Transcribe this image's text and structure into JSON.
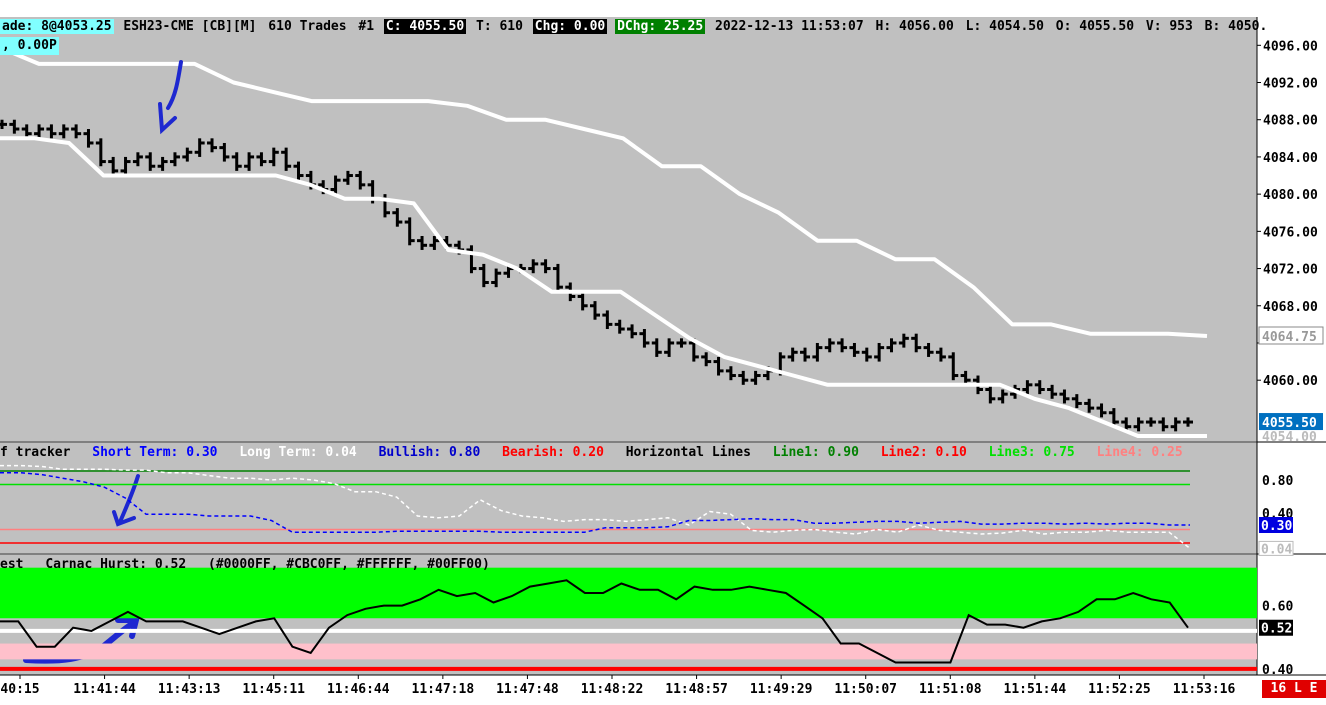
{
  "header": {
    "last_trade": "ade: 8@4053.25",
    "symbol": "ESH23-CME [CB][M]",
    "trades": "610 Trades",
    "num": "#1",
    "close": "C: 4055.50",
    "t": "T: 610",
    "chg": "Chg: 0.00",
    "dchg": "DChg: 25.25",
    "datetime": "2022-12-13 11:53:07",
    "high": "H: 4056.00",
    "low": "L: 4054.50",
    "open": "O: 4055.50",
    "volume": "V: 953",
    "bid": "B: 4050.",
    "sub": ", 0.00P"
  },
  "colors": {
    "chart_bg": "#C0C0C0",
    "price_axis_bg": "#FFFFFF",
    "cyan_label": "#80FFFF",
    "dchg_bg": "#008000",
    "price_tag_bg": "#0070C0",
    "short_term": "#0000FF",
    "long_term": "#FFFFFF",
    "bullish_zone": "#00FF00",
    "bearish_zone": "#FFC0CB",
    "red_line": "#FF0000"
  },
  "price_axis": {
    "labels": [
      "4096.00",
      "4092.00",
      "4088.00",
      "4084.00",
      "4080.00",
      "4076.00",
      "4072.00",
      "4068.00",
      "4064.75",
      "4060.00",
      "4055.50",
      "4054.00"
    ],
    "current_tag": "4055.50",
    "upper_band_tag": "4064.75",
    "lower_band_tag": "4054.00"
  },
  "panel2": {
    "title": "f tracker",
    "short_term": "Short Term: 0.30",
    "long_term": "Long Term: 0.04",
    "bullish": "Bullish: 0.80",
    "bearish": "Bearish: 0.20",
    "hlines": "Horizontal Lines",
    "line1": "Line1: 0.90",
    "line2": "Line2: 0.10",
    "line3": "Line3: 0.75",
    "line4": "Line4: 0.25",
    "axis": [
      "0.80",
      "0.40"
    ],
    "tag_short": "0.30",
    "tag_long": "0.04"
  },
  "panel3": {
    "title": "est",
    "carnac": "Carnac Hurst: 0.52",
    "colors_text": "(#0000FF, #CBC0FF, #FFFFFF, #00FF00)",
    "axis": [
      "0.60",
      "0.40"
    ],
    "tag": "0.52"
  },
  "time_axis": [
    "40:15",
    "11:41:44",
    "11:43:13",
    "11:45:11",
    "11:46:44",
    "11:47:18",
    "11:47:48",
    "11:48:22",
    "11:48:57",
    "11:49:29",
    "11:50:07",
    "11:51:08",
    "11:51:44",
    "11:52:25",
    "11:53:16"
  ],
  "status": "16 L E",
  "chart_data": [
    {
      "type": "bar",
      "name": "price",
      "ohlc_close": [
        4087.5,
        4087,
        4086.5,
        4087,
        4086.5,
        4087,
        4086.5,
        4085.5,
        4083.5,
        4082.5,
        4083.5,
        4084,
        4083,
        4083.5,
        4084,
        4084.5,
        4085.5,
        4085,
        4084,
        4083,
        4084,
        4083.5,
        4084.5,
        4083,
        4082,
        4081,
        4080.5,
        4081.5,
        4082,
        4081,
        4079.5,
        4078,
        4077,
        4075,
        4074.5,
        4075,
        4074.5,
        4074,
        4072,
        4070.5,
        4071.5,
        4072,
        4072,
        4072.5,
        4072,
        4070,
        4069,
        4068,
        4067,
        4066,
        4065.5,
        4065,
        4064,
        4063,
        4064,
        4064,
        4062.5,
        4062,
        4061,
        4060.5,
        4060,
        4060.5,
        4061,
        4062.5,
        4063,
        4062.5,
        4063.5,
        4064,
        4063.5,
        4063,
        4062.5,
        4063.5,
        4064,
        4064.5,
        4063.5,
        4063,
        4062.5,
        4060.5,
        4060,
        4059,
        4058,
        4058.5,
        4059,
        4059.5,
        4059,
        4058.5,
        4058,
        4057.5,
        4057,
        4056.5,
        4055.5,
        4055,
        4055.5,
        4055.5,
        4055,
        4055.5,
        4055.5
      ],
      "upper_band": [
        4095.75,
        4094,
        4094,
        4094,
        4094,
        4094,
        4092,
        4091,
        4090,
        4090,
        4090,
        4090,
        4089.5,
        4088,
        4088,
        4087,
        4086,
        4083,
        4083,
        4080,
        4078,
        4075,
        4075,
        4073,
        4073,
        4070,
        4066,
        4066,
        4065,
        4065,
        4065,
        4064.75
      ],
      "lower_band": [
        4086,
        4086,
        4085.5,
        4082,
        4082,
        4082,
        4082,
        4082,
        4082,
        4081,
        4079.5,
        4079.5,
        4079,
        4074,
        4073.5,
        4072,
        4069.5,
        4069.5,
        4069.5,
        4067,
        4064.5,
        4062.5,
        4061.5,
        4060.5,
        4059.5,
        4059.5,
        4059.5,
        4059.5,
        4059.5,
        4059.5,
        4058,
        4057,
        4055.5,
        4054,
        4054,
        4054
      ],
      "ylim": [
        4054,
        4097
      ]
    },
    {
      "type": "line",
      "name": "tracker",
      "series": [
        {
          "name": "Short Term",
          "values": [
            0.88,
            0.88,
            0.86,
            0.82,
            0.78,
            0.72,
            0.6,
            0.42,
            0.42,
            0.42,
            0.4,
            0.4,
            0.4,
            0.35,
            0.22,
            0.22,
            0.22,
            0.22,
            0.22,
            0.23,
            0.23,
            0.23,
            0.23,
            0.23,
            0.22,
            0.22,
            0.22,
            0.22,
            0.22,
            0.27,
            0.27,
            0.27,
            0.28,
            0.35,
            0.35,
            0.36,
            0.37,
            0.36,
            0.36,
            0.32,
            0.32,
            0.33,
            0.34,
            0.34,
            0.32,
            0.33,
            0.34,
            0.31,
            0.31,
            0.32,
            0.32,
            0.31,
            0.32,
            0.31,
            0.32,
            0.32,
            0.3,
            0.3
          ]
        },
        {
          "name": "Long Term",
          "values": [
            0.96,
            0.96,
            0.95,
            0.92,
            0.92,
            0.92,
            0.91,
            0.91,
            0.88,
            0.88,
            0.85,
            0.82,
            0.82,
            0.8,
            0.82,
            0.8,
            0.76,
            0.67,
            0.67,
            0.61,
            0.4,
            0.38,
            0.4,
            0.58,
            0.46,
            0.4,
            0.38,
            0.34,
            0.36,
            0.36,
            0.34,
            0.36,
            0.38,
            0.3,
            0.45,
            0.42,
            0.24,
            0.22,
            0.24,
            0.25,
            0.22,
            0.2,
            0.25,
            0.22,
            0.3,
            0.24,
            0.22,
            0.2,
            0.21,
            0.24,
            0.2,
            0.22,
            0.22,
            0.24,
            0.22,
            0.22,
            0.22,
            0.04
          ]
        }
      ],
      "hlines": [
        0.9,
        0.75,
        0.25,
        0.1
      ],
      "ylim": [
        0,
        1
      ]
    },
    {
      "type": "line",
      "name": "Carnac Hurst",
      "values": [
        0.55,
        0.55,
        0.47,
        0.47,
        0.53,
        0.52,
        0.55,
        0.58,
        0.55,
        0.55,
        0.55,
        0.53,
        0.51,
        0.53,
        0.55,
        0.56,
        0.47,
        0.45,
        0.53,
        0.57,
        0.59,
        0.6,
        0.6,
        0.62,
        0.65,
        0.63,
        0.64,
        0.61,
        0.63,
        0.66,
        0.67,
        0.68,
        0.64,
        0.64,
        0.67,
        0.65,
        0.65,
        0.62,
        0.66,
        0.65,
        0.65,
        0.66,
        0.65,
        0.64,
        0.6,
        0.56,
        0.48,
        0.48,
        0.45,
        0.42,
        0.42,
        0.42,
        0.42,
        0.57,
        0.54,
        0.54,
        0.53,
        0.55,
        0.56,
        0.58,
        0.62,
        0.62,
        0.64,
        0.62,
        0.61,
        0.53
      ],
      "zones": {
        "bullish": [
          0.56,
          0.72
        ],
        "bearish": [
          0.43,
          0.48
        ]
      },
      "ylim": [
        0.39,
        0.7
      ]
    }
  ]
}
